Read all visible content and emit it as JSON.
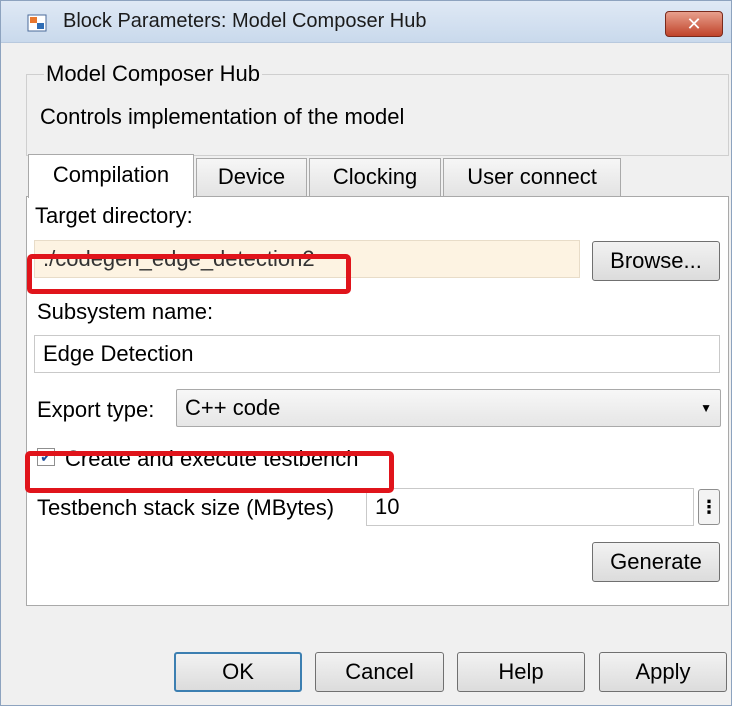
{
  "window": {
    "title": "Block Parameters: Model Composer Hub",
    "close_label": "✕"
  },
  "header": {
    "block_name": "Model Composer Hub",
    "description": "Controls implementation of the model"
  },
  "tabs": [
    {
      "label": "Compilation",
      "active": true
    },
    {
      "label": "Device",
      "active": false
    },
    {
      "label": "Clocking",
      "active": false
    },
    {
      "label": "User connect",
      "active": false
    }
  ],
  "compilation": {
    "target_directory_label": "Target directory:",
    "target_directory_value": "./codegen_edge_detection2",
    "browse_label": "Browse...",
    "subsystem_name_label": "Subsystem name:",
    "subsystem_name_value": "Edge Detection",
    "export_type_label": "Export type:",
    "export_type_value": "C++ code",
    "testbench_label": "Create and execute testbench",
    "testbench_checked": true,
    "stack_size_label": "Testbench stack size (MBytes)",
    "stack_size_value": "10",
    "more_label": "⋮",
    "generate_label": "Generate"
  },
  "footer": {
    "ok_label": "OK",
    "cancel_label": "Cancel",
    "help_label": "Help",
    "apply_label": "Apply"
  },
  "colors": {
    "highlight": "#e0141b",
    "readonly_field": "#fdf3e2",
    "default_button_border": "#3c7fb1"
  },
  "icons": {
    "app": "simulink-block-icon",
    "close": "close-icon",
    "dropdown": "chevron-down-icon",
    "check": "checkmark-icon"
  }
}
